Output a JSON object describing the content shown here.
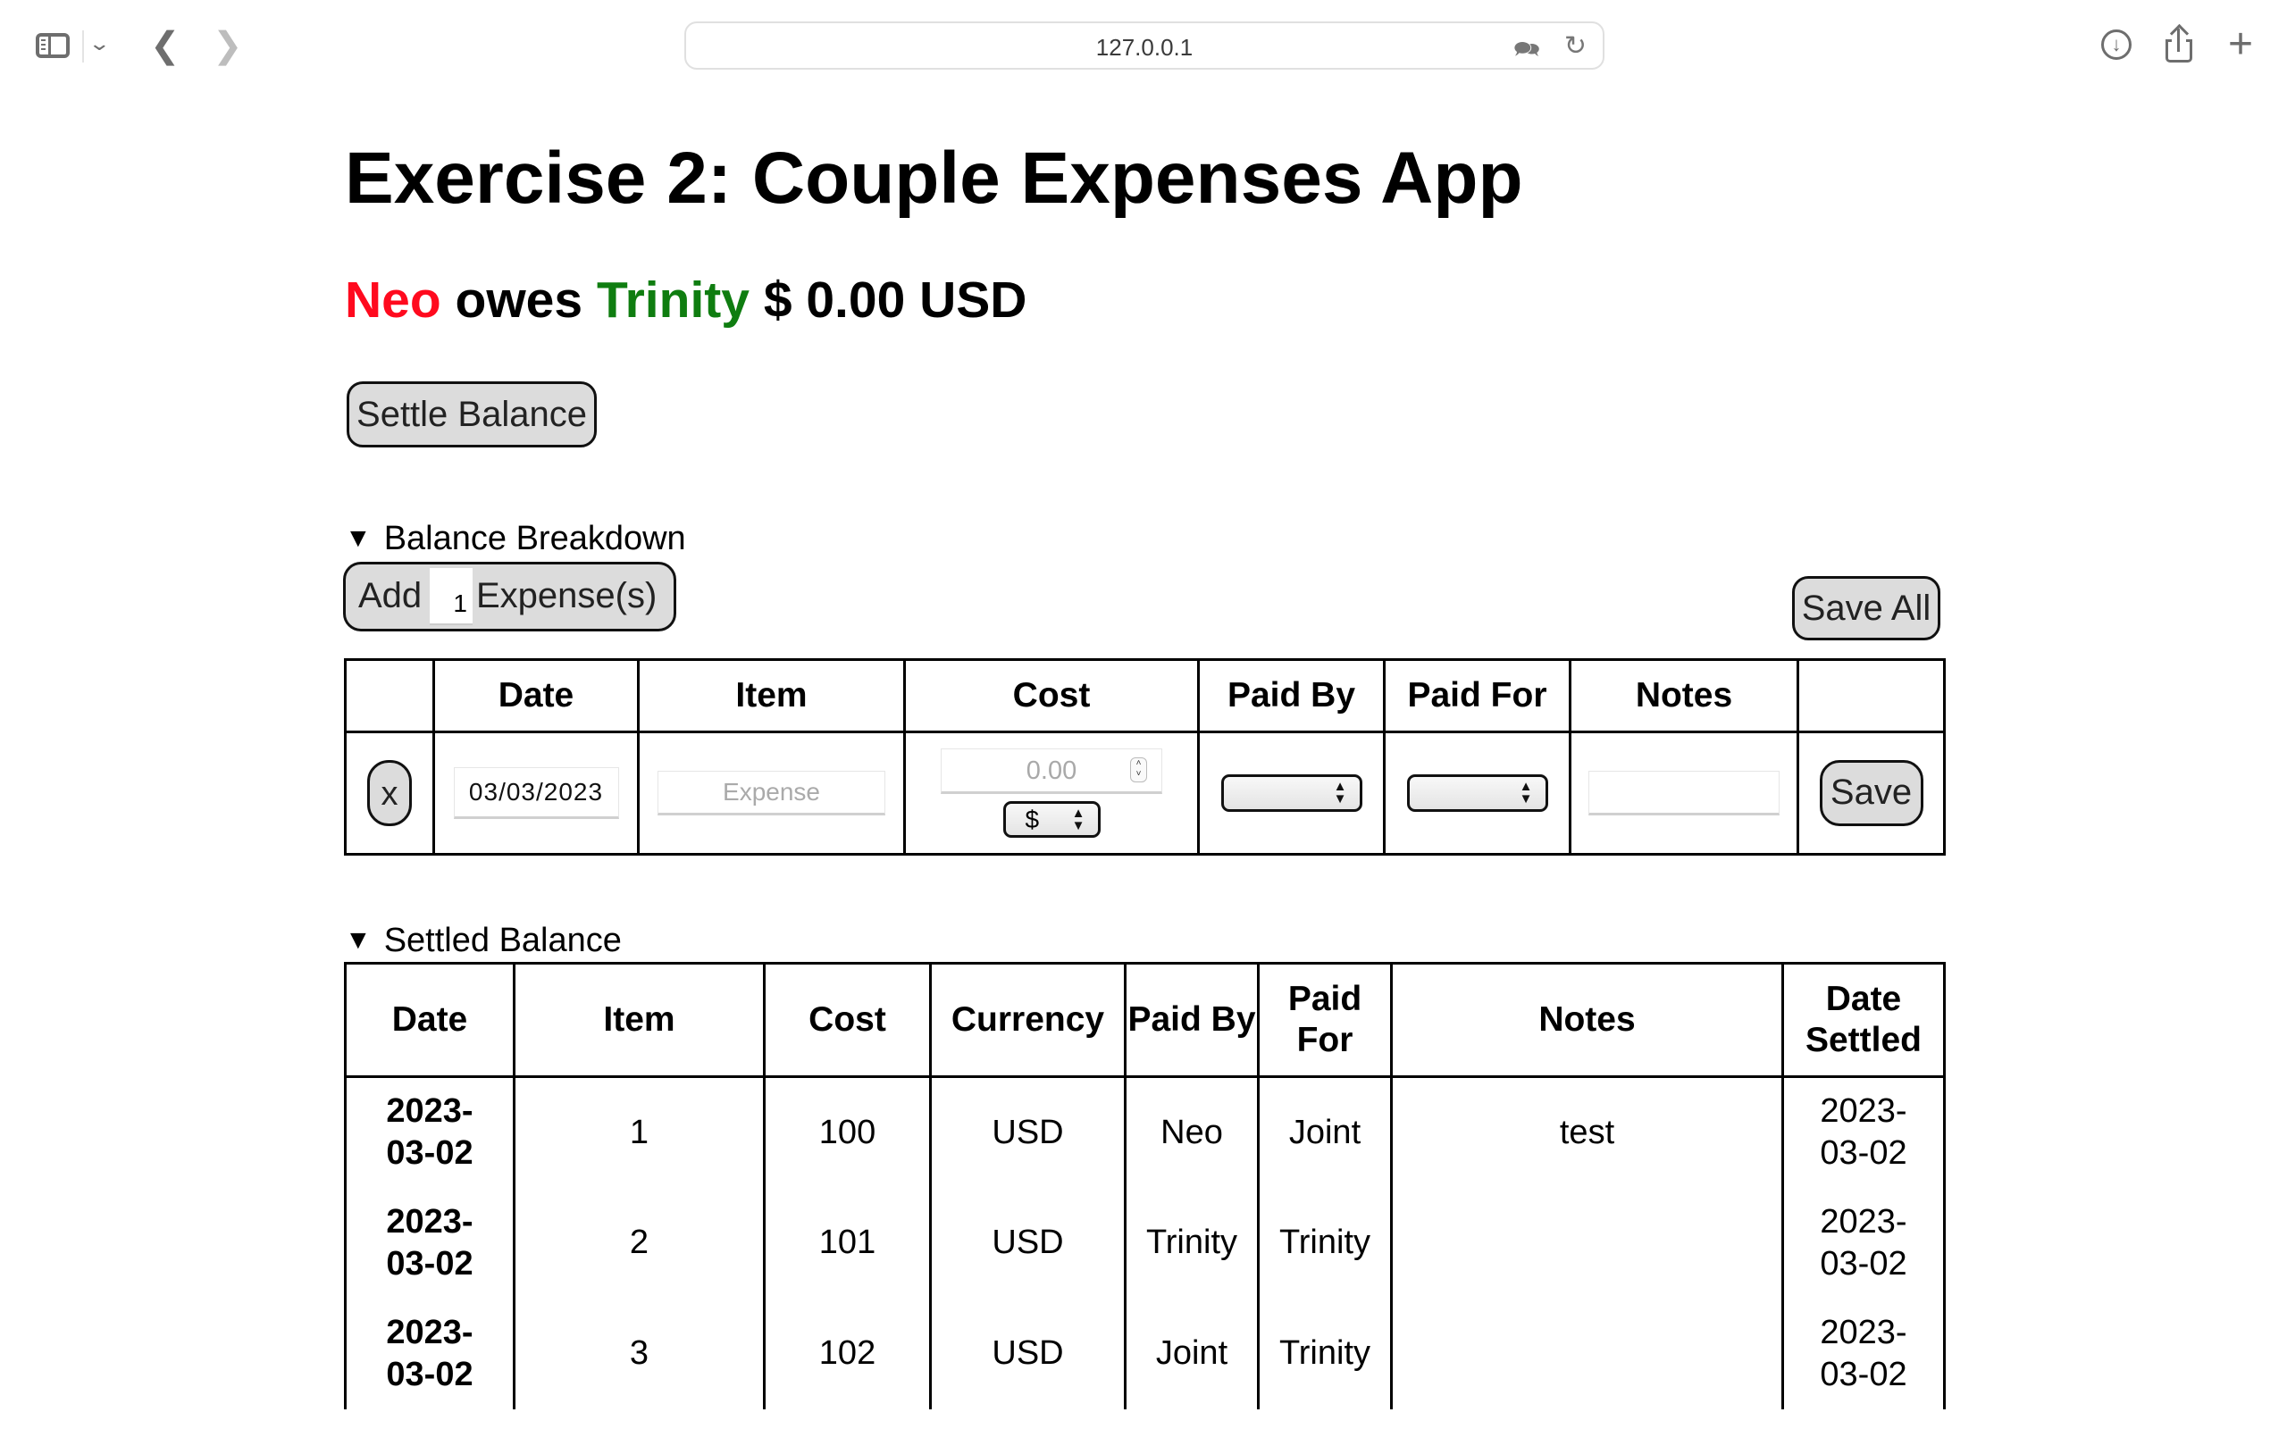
{
  "browser": {
    "url": "127.0.0.1",
    "icons": [
      "sidebar-icon",
      "chevron-down-icon",
      "back-icon",
      "forward-icon",
      "translate-icon",
      "reload-icon",
      "download-icon",
      "share-icon",
      "new-tab-icon"
    ]
  },
  "header": {
    "title": "Exercise 2: Couple Expenses App",
    "balance": {
      "debtor": "Neo",
      "verb": "owes",
      "creditor": "Trinity",
      "amount": "$ 0.00 USD",
      "debtor_color": "#ff0a1e",
      "creditor_color": "#0f7d10"
    },
    "settle_button": "Settle Balance"
  },
  "breakdown": {
    "summary": "Balance Breakdown",
    "add_label_pre": "Add",
    "add_count": "1",
    "add_label_post": "Expense(s)",
    "save_all": "Save All",
    "columns": [
      "",
      "Date",
      "Item",
      "Cost",
      "Paid By",
      "Paid For",
      "Notes",
      ""
    ],
    "row": {
      "delete_label": "x",
      "date": "03/03/2023",
      "item_placeholder": "Expense",
      "cost_placeholder": "0.00",
      "currency": "$",
      "paid_by": "",
      "paid_for": "",
      "notes": "",
      "save_label": "Save"
    }
  },
  "settled": {
    "summary": "Settled Balance",
    "columns": [
      "Date",
      "Item",
      "Cost",
      "Currency",
      "Paid By",
      "Paid For",
      "Notes",
      "Date Settled"
    ],
    "rows": [
      {
        "date": "2023-03-02",
        "item": "1",
        "cost": "100",
        "currency": "USD",
        "paid_by": "Neo",
        "paid_for": "Joint",
        "notes": "test",
        "date_settled": "2023-03-02"
      },
      {
        "date": "2023-03-02",
        "item": "2",
        "cost": "101",
        "currency": "USD",
        "paid_by": "Trinity",
        "paid_for": "Trinity",
        "notes": "",
        "date_settled": "2023-03-02"
      },
      {
        "date": "2023-03-02",
        "item": "3",
        "cost": "102",
        "currency": "USD",
        "paid_by": "Joint",
        "paid_for": "Trinity",
        "notes": "",
        "date_settled": "2023-03-02"
      }
    ]
  }
}
